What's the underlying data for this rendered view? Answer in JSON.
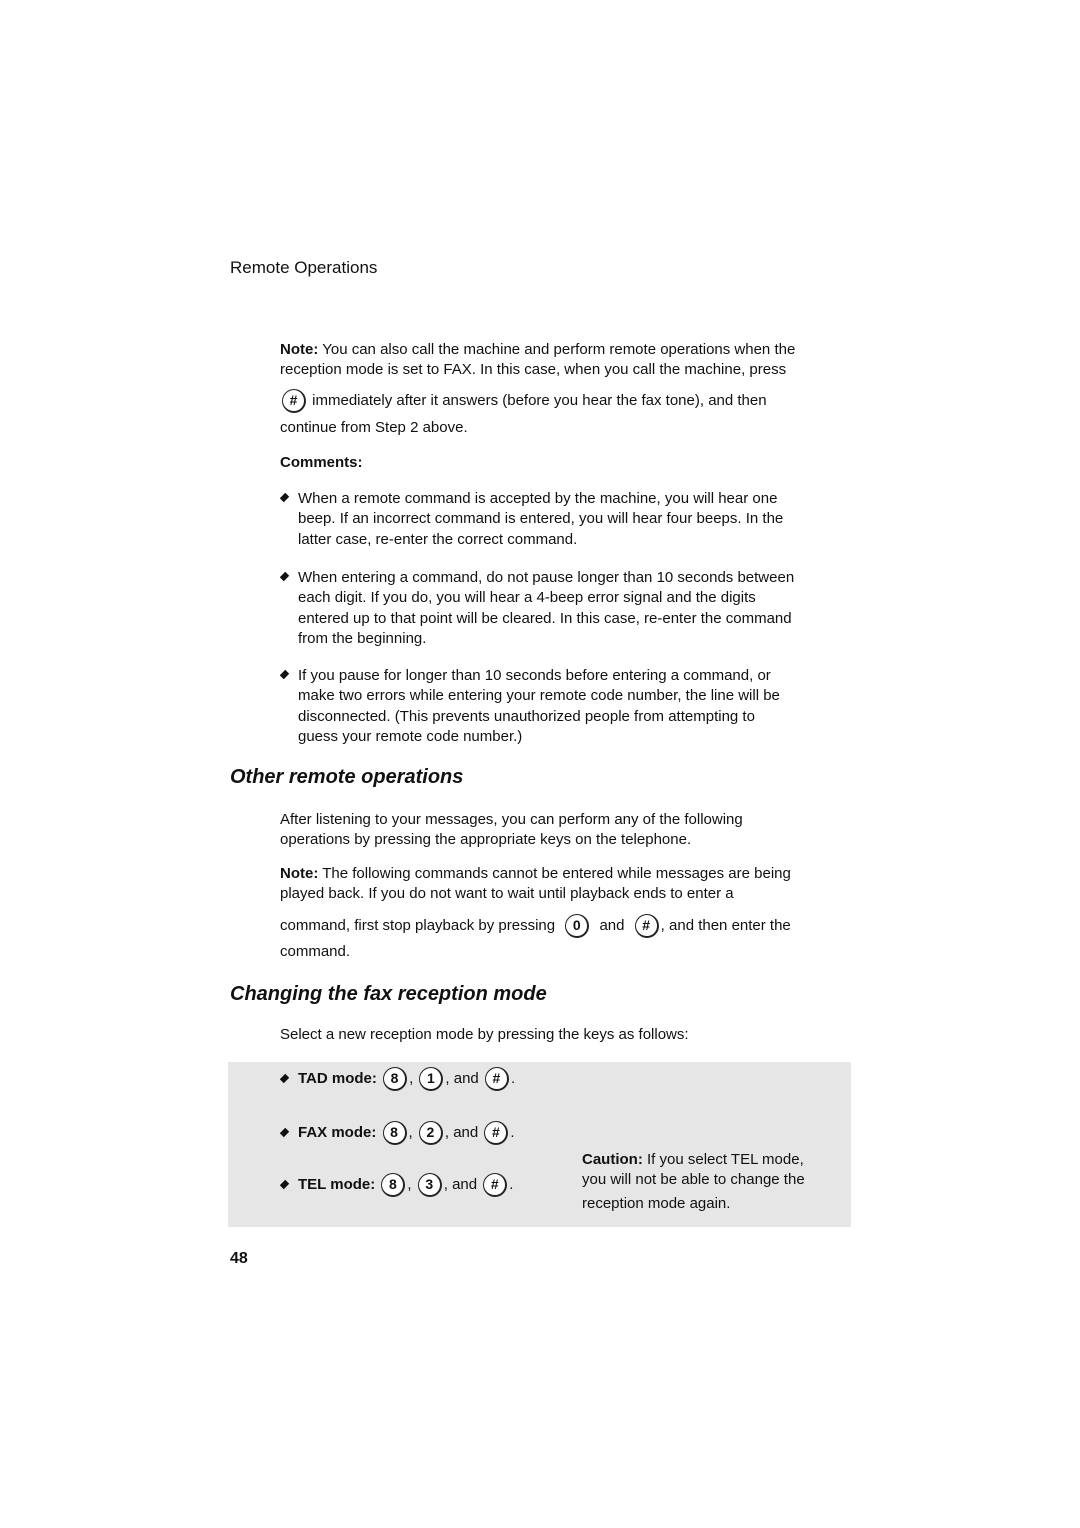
{
  "header": {
    "section": "Remote Operations"
  },
  "note1": {
    "label": "Note:",
    "lines": [
      "You can also call the machine and perform remote operations when the",
      "reception mode is set to FAX. In this case, when you call the machine, press"
    ],
    "key": "#",
    "after_key": "immediately after it answers (before you hear the fax tone), and then",
    "last": "continue from Step 2 above."
  },
  "comments": {
    "title": "Comments:",
    "items": [
      [
        "When a remote command is accepted by the machine, you will hear one",
        "beep. If an incorrect command is entered, you will hear four beeps. In the",
        "latter case, re-enter the correct command."
      ],
      [
        "When entering a command, do not pause longer than 10 seconds between",
        "each digit. If you do, you will hear a 4-beep error signal and the digits",
        "entered up to that point will be cleared. In this case, re-enter the command",
        "from the beginning."
      ],
      [
        "If you pause for longer than 10 seconds before entering a command, or",
        "make two errors while entering your remote code number, the line will be",
        "disconnected. (This prevents unauthorized people from attempting to",
        "guess your remote code number.)"
      ]
    ]
  },
  "other": {
    "heading": "Other remote operations",
    "lines": [
      "After listening to your messages, you can perform any of the following",
      "operations by pressing the appropriate keys on the telephone."
    ],
    "note_label": "Note:",
    "note_lines": [
      "The following commands cannot be entered while messages are being",
      "played back. If you do not want to wait until playback ends to enter a"
    ],
    "cmd_pre": "command, first stop playback by pressing",
    "key1": "0",
    "and": "and",
    "key2": "#",
    "cmd_post": ", and then enter the",
    "last": "command."
  },
  "changing": {
    "heading": "Changing the fax reception mode",
    "intro": "Select a new reception mode by pressing the keys as follows:",
    "modes": [
      {
        "label": "TAD mode:",
        "k1": "8",
        "k2": "1",
        "k3": "#"
      },
      {
        "label": "FAX mode:",
        "k1": "8",
        "k2": "2",
        "k3": "#"
      },
      {
        "label": "TEL mode:",
        "k1": "8",
        "k2": "3",
        "k3": "#"
      }
    ],
    "comma": ",",
    "and": ", and",
    "period": ".",
    "caution_label": "Caution:",
    "caution_lines": [
      "If you select TEL mode,",
      "you will not be able to change the",
      "reception mode again."
    ]
  },
  "page_number": "48"
}
